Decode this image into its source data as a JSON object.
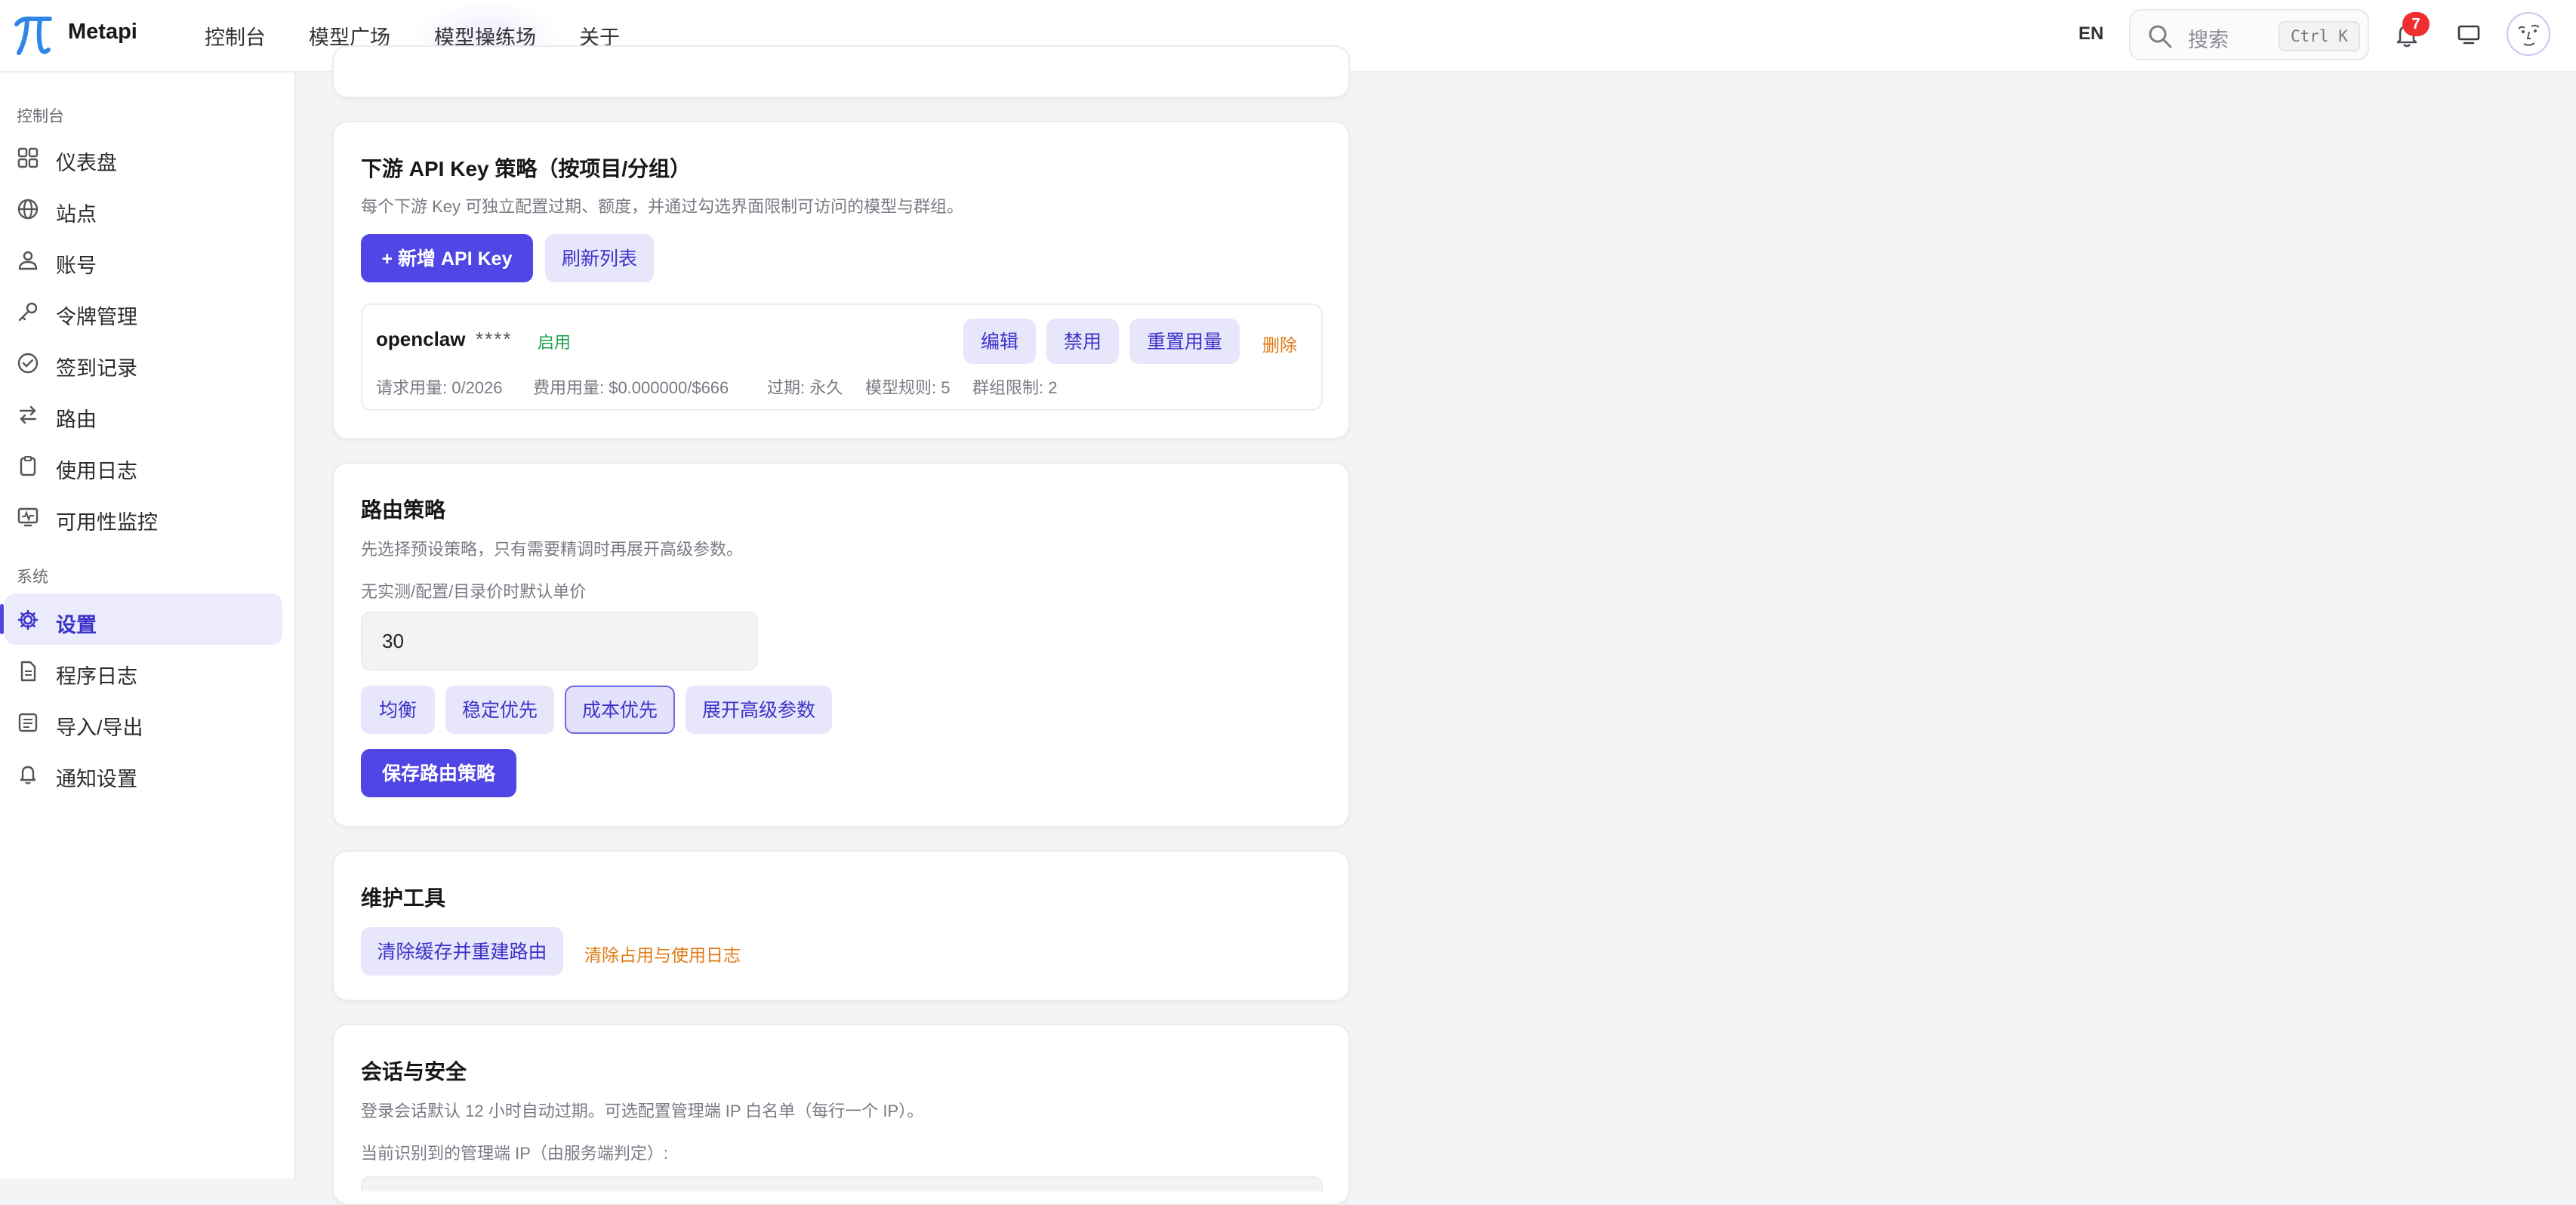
{
  "header": {
    "brand": "Metapi",
    "nav": [
      "控制台",
      "模型广场",
      "模型操练场",
      "关于"
    ],
    "lang": "EN",
    "search": {
      "placeholder": "搜索",
      "shortcut": "Ctrl K"
    },
    "notification_count": "7"
  },
  "sidebar": {
    "section_console": "控制台",
    "items_console": [
      "仪表盘",
      "站点",
      "账号",
      "令牌管理",
      "签到记录",
      "路由",
      "使用日志",
      "可用性监控"
    ],
    "section_system": "系统",
    "items_system": [
      "设置",
      "程序日志",
      "导入/导出",
      "通知设置"
    ],
    "active_item": "设置"
  },
  "api_keys": {
    "title": "下游 API Key 策略（按项目/分组）",
    "desc": "每个下游 Key 可独立配置过期、额度，并通过勾选界面限制可访问的模型与群组。",
    "add_label": "+ 新增 API Key",
    "refresh_label": "刷新列表",
    "key": {
      "name": "openclaw",
      "mask": "****",
      "status": "启用",
      "edit": "编辑",
      "disable": "禁用",
      "reset": "重置用量",
      "delete": "删除",
      "req_usage": "请求用量: 0/2026",
      "cost_usage": "费用用量: $0.000000/$666",
      "expire": "过期: 永久",
      "model_rules": "模型规则: 5",
      "group_limit": "群组限制: 2"
    }
  },
  "routing": {
    "title": "路由策略",
    "desc": "先选择预设策略，只有需要精调时再展开高级参数。",
    "price_label": "无实测/配置/目录价时默认单价",
    "price_value": "30",
    "presets": [
      "均衡",
      "稳定优先",
      "成本优先",
      "展开高级参数"
    ],
    "selected_preset": "成本优先",
    "save_label": "保存路由策略"
  },
  "maintenance": {
    "title": "维护工具",
    "rebuild_label": "清除缓存并重建路由",
    "clear_label": "清除占用与使用日志"
  },
  "session": {
    "title": "会话与安全",
    "desc": "登录会话默认 12 小时自动过期。可选配置管理端 IP 白名单（每行一个 IP）。",
    "ip_label": "当前识别到的管理端 IP（由服务端判定）:"
  },
  "colors": {
    "accent": "#4f46e5",
    "accent_soft": "#e8e6fb",
    "success": "#1f9d4b",
    "warning": "#e07b14",
    "badge": "#ef2f2f"
  },
  "icons": {
    "logo": "pi-logo",
    "search": "search-icon",
    "notification": "bell-icon",
    "display": "monitor-icon"
  }
}
